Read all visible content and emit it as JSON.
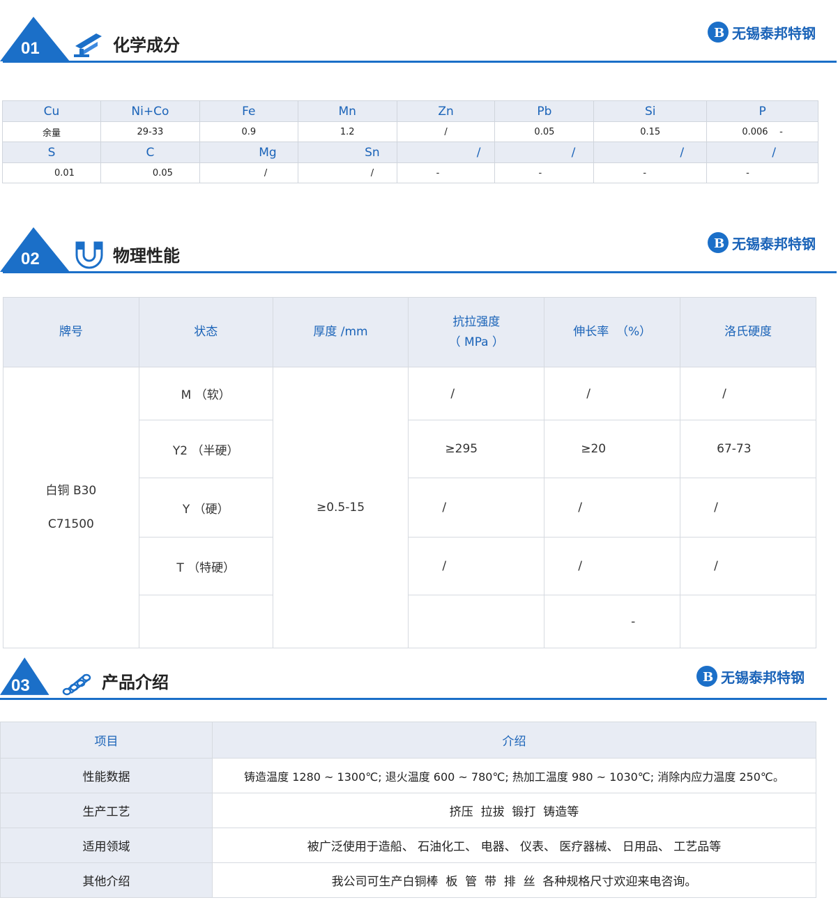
{
  "brand": "无锡泰邦特钢",
  "sections": [
    {
      "num": "01",
      "title": "化学成分"
    },
    {
      "num": "02",
      "title": "物理性能"
    },
    {
      "num": "03",
      "title": "产品介绍"
    }
  ],
  "chem": {
    "row1_headers": [
      "Cu",
      "Ni+Co",
      "Fe",
      "Mn",
      "Zn",
      "Pb",
      "Si",
      "P"
    ],
    "row1_values": [
      "余量",
      "29-33",
      "0.9",
      "1.2",
      "/",
      "0.05",
      "0.15",
      "0.006    -"
    ],
    "row2_headers": [
      "S",
      "C",
      "Mg",
      "Sn",
      "/",
      "/",
      "/",
      "/"
    ],
    "row2_values": [
      "0.01",
      "0.05",
      "/",
      "/",
      "-",
      "-",
      "-",
      "-"
    ]
  },
  "phys": {
    "headers": [
      "牌号",
      "状态",
      "厚度 /mm",
      "抗拉强度",
      "（ MPa ）",
      "伸长率  （%）",
      "洛氏硬度"
    ],
    "grade_line1": "白铜 B30",
    "grade_line2": "C71500",
    "thickness": "≥0.5-15",
    "rows": [
      {
        "state": "M （软）",
        "tensile": "/",
        "elong": "/",
        "hard": "/"
      },
      {
        "state": "Y2 （半硬）",
        "tensile": "≥295",
        "elong": "≥20",
        "hard": "67-73"
      },
      {
        "state": "Y （硬）",
        "tensile": "/",
        "elong": "/",
        "hard": "/"
      },
      {
        "state": "T （特硬）",
        "tensile": "/",
        "elong": "/",
        "hard": "/"
      },
      {
        "state": "",
        "tensile": "",
        "elong": "-",
        "hard": ""
      }
    ]
  },
  "intro": {
    "headers": [
      "项目",
      "介绍"
    ],
    "rows": [
      {
        "label": "性能数据",
        "text": "铸造温度 1280 ~ 1300℃; 退火温度 600 ~ 780℃; 热加工温度 980 ~ 1030℃; 消除内应力温度 250℃。"
      },
      {
        "label": "生产工艺",
        "text": "挤压  拉拔  锻打  铸造等"
      },
      {
        "label": "适用领域",
        "text": "被广泛使用于造船、 石油化工、 电器、 仪表、 医疗器械、 日用品、 工艺品等"
      },
      {
        "label": "其他介绍",
        "text": "我公司可生产白铜棒  板  管  带  排  丝  各种规格尺寸欢迎来电咨询。"
      }
    ]
  }
}
